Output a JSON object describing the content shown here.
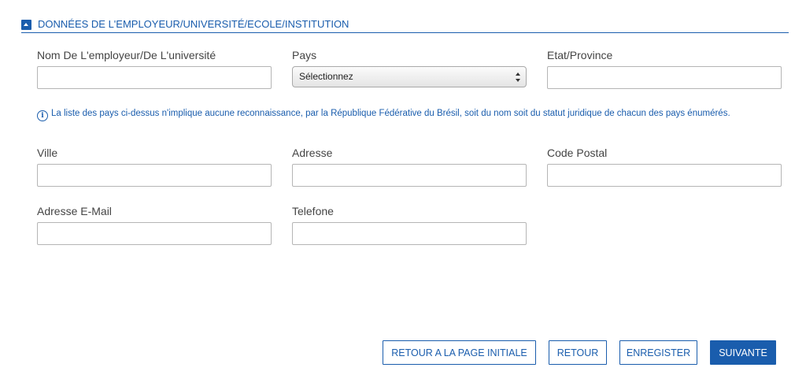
{
  "section": {
    "title": "DONNÉES DE L'EMPLOYEUR/UNIVERSITÉ/ECOLE/INSTITUTION",
    "icon": "chevron-up-icon"
  },
  "fields": {
    "employer_name": {
      "label": "Nom De L'employeur/De L'université",
      "value": ""
    },
    "country": {
      "label": "Pays",
      "selected": "Sélectionnez"
    },
    "state": {
      "label": "Etat/Province",
      "value": ""
    },
    "city": {
      "label": "Ville",
      "value": ""
    },
    "address": {
      "label": "Adresse",
      "value": ""
    },
    "postal_code": {
      "label": "Code Postal",
      "value": ""
    },
    "email": {
      "label": "Adresse E-Mail",
      "value": ""
    },
    "phone": {
      "label": "Telefone",
      "value": ""
    }
  },
  "notice": {
    "icon": "info-icon",
    "text": "La liste des pays ci-dessus n'implique aucune reconnaissance, par la République Fédérative du Brésil, soit du nom soit du statut juridique de chacun des pays énumérés."
  },
  "buttons": {
    "home": "RETOUR A LA PAGE INITIALE",
    "back": "RETOUR",
    "save": "ENREGISTER",
    "next": "SUIVANTE"
  },
  "colors": {
    "accent": "#1a5dad",
    "label_text": "#444444",
    "input_border": "#b5b5b5"
  }
}
